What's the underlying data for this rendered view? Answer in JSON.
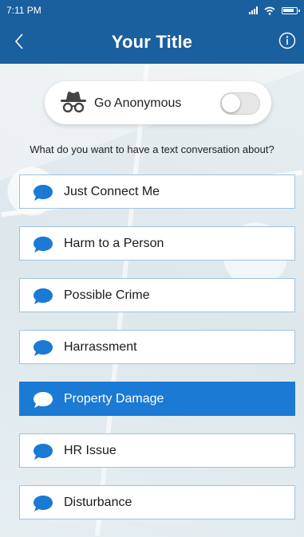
{
  "status_bar": {
    "time": "7:11 PM"
  },
  "header": {
    "title": "Your Title"
  },
  "anonymous": {
    "label": "Go Anonymous",
    "enabled": false
  },
  "prompt": "What do you want to have a text conversation about?",
  "topics": [
    {
      "label": "Just Connect Me",
      "selected": false
    },
    {
      "label": "Harm to a Person",
      "selected": false
    },
    {
      "label": "Possible Crime",
      "selected": false
    },
    {
      "label": "Harrassment",
      "selected": false
    },
    {
      "label": "Property Damage",
      "selected": true
    },
    {
      "label": "HR Issue",
      "selected": false
    },
    {
      "label": "Disturbance",
      "selected": false
    }
  ],
  "colors": {
    "header": "#1a5f9e",
    "accent": "#1a7ad4",
    "bubble": "#1a7ad4",
    "option_border": "#9fc3de"
  }
}
